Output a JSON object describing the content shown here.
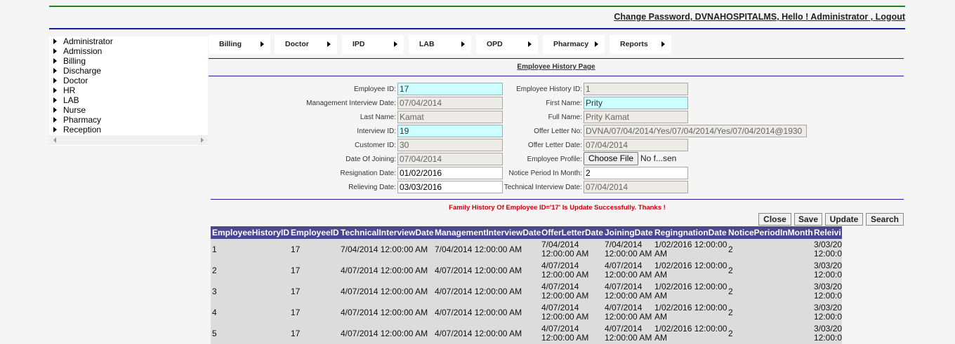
{
  "header": {
    "links": [
      "Change Password",
      "DVNAHOSPITALMS",
      "Hello ! Administrator",
      "Logout"
    ],
    "separators": [
      ", ",
      ", ",
      " , "
    ]
  },
  "sidebar": {
    "items": [
      "Administrator",
      "Admission",
      "Billing",
      "Discharge",
      "Doctor",
      "HR",
      "LAB",
      "Nurse",
      "Pharmacy",
      "Reception"
    ]
  },
  "menu": {
    "items": [
      "Billing",
      "Doctor",
      "IPD",
      "LAB",
      "OPD",
      "Pharmacy",
      "Reports"
    ]
  },
  "page": {
    "title": "Employee History Page"
  },
  "form": {
    "employee_id": {
      "label": "Employee ID:",
      "value": "17"
    },
    "mgmt_interview_date": {
      "label": "Management Interview Date:",
      "value": "07/04/2014"
    },
    "last_name": {
      "label": "Last Name:",
      "value": "Kamat"
    },
    "interview_id": {
      "label": "Interview ID:",
      "value": "19"
    },
    "customer_id": {
      "label": "Customer ID:",
      "value": "30"
    },
    "date_of_joining": {
      "label": "Date Of Joining:",
      "value": "07/04/2014"
    },
    "resignation_date": {
      "label": "Resignation Date:",
      "value": "01/02/2016"
    },
    "relieving_date": {
      "label": "Relieving Date:",
      "value": "03/03/2016"
    },
    "employee_history_id": {
      "label": "Employee History ID:",
      "value": "1"
    },
    "first_name": {
      "label": "First Name:",
      "value": "Prity"
    },
    "full_name": {
      "label": "Full Name:",
      "value": "Prity Kamat"
    },
    "offer_letter_no": {
      "label": "Offer Letter No:",
      "value": "DVNA/07/04/2014/Yes/07/04/2014/Yes/07/04/2014@1930"
    },
    "offer_letter_date": {
      "label": "Offer Letter Date:",
      "value": "07/04/2014"
    },
    "employee_profile": {
      "label": "Employee Profile:",
      "button": "Choose File",
      "file_text": "No f...sen"
    },
    "notice_period": {
      "label": "Notice Period In Month:",
      "value": "2"
    },
    "technical_interview_date": {
      "label": "Technical Interview Date:",
      "value": "07/04/2014"
    }
  },
  "message": "Family History Of Employee ID='17' Is Update Successfully. Thanks !",
  "buttons": {
    "close": "Close",
    "save": "Save",
    "update": "Update",
    "search": "Search"
  },
  "table": {
    "columns": [
      "EmployeeHistoryID",
      "EmployeeID",
      "TechnicalInterviewDate",
      "ManagementInterviewDate",
      "OfferLetterDate",
      "JoiningDate",
      "RegingnationDate",
      "NoticePeriodInMonth",
      "Releivi"
    ],
    "rows": [
      [
        "1",
        "17",
        "7/04/2014 12:00:00 AM",
        "7/04/2014 12:00:00 AM",
        [
          "7/04/2014",
          "12:00:00 AM"
        ],
        [
          "7/04/2014",
          "12:00:00 AM"
        ],
        [
          "1/02/2016 12:00:00",
          "AM"
        ],
        "2",
        [
          "3/03/20",
          "12:00:0"
        ]
      ],
      [
        "2",
        "17",
        "4/07/2014 12:00:00 AM",
        "4/07/2014 12:00:00 AM",
        [
          "4/07/2014",
          "12:00:00 AM"
        ],
        [
          "4/07/2014",
          "12:00:00 AM"
        ],
        [
          "1/02/2016 12:00:00",
          "AM"
        ],
        "2",
        [
          "3/03/20",
          "12:00:0"
        ]
      ],
      [
        "3",
        "17",
        "4/07/2014 12:00:00 AM",
        "4/07/2014 12:00:00 AM",
        [
          "4/07/2014",
          "12:00:00 AM"
        ],
        [
          "4/07/2014",
          "12:00:00 AM"
        ],
        [
          "1/02/2016 12:00:00",
          "AM"
        ],
        "2",
        [
          "3/03/20",
          "12:00:0"
        ]
      ],
      [
        "4",
        "17",
        "4/07/2014 12:00:00 AM",
        "4/07/2014 12:00:00 AM",
        [
          "4/07/2014",
          "12:00:00 AM"
        ],
        [
          "4/07/2014",
          "12:00:00 AM"
        ],
        [
          "1/02/2016 12:00:00",
          "AM"
        ],
        "2",
        [
          "3/03/20",
          "12:00:0"
        ]
      ],
      [
        "5",
        "17",
        "4/07/2014 12:00:00 AM",
        "4/07/2014 12:00:00 AM",
        [
          "4/07/2014",
          "12:00:00 AM"
        ],
        [
          "4/07/2014",
          "12:00:00 AM"
        ],
        [
          "1/02/2016 12:00:00",
          "AM"
        ],
        "2",
        [
          "3/03/20",
          "12:00:0"
        ]
      ]
    ]
  }
}
